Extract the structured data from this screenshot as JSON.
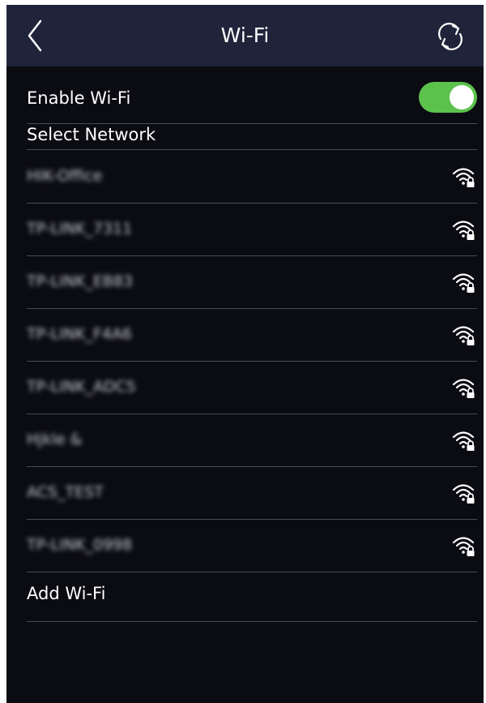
{
  "header": {
    "title": "Wi-Fi",
    "back_icon": "chevron-left-icon",
    "refresh_icon": "refresh-icon"
  },
  "enable": {
    "label": "Enable Wi-Fi",
    "enabled": true,
    "toggle_color": "#5bc24c"
  },
  "section": {
    "label": "Select Network"
  },
  "networks": [
    {
      "ssid": "HIK-Office"
    },
    {
      "ssid": "TP-LINK_7311"
    },
    {
      "ssid": "TP-LINK_EB83"
    },
    {
      "ssid": "TP-LINK_F4A6"
    },
    {
      "ssid": "TP-LINK_ADC5"
    },
    {
      "ssid": "Hjkle &"
    },
    {
      "ssid": "ACS_TEST"
    },
    {
      "ssid": "TP-LINK_0998"
    }
  ],
  "add": {
    "label": "Add Wi-Fi"
  },
  "colors": {
    "background": "#0b0b12",
    "header": "#20243a",
    "divider": "#4a4a52"
  }
}
